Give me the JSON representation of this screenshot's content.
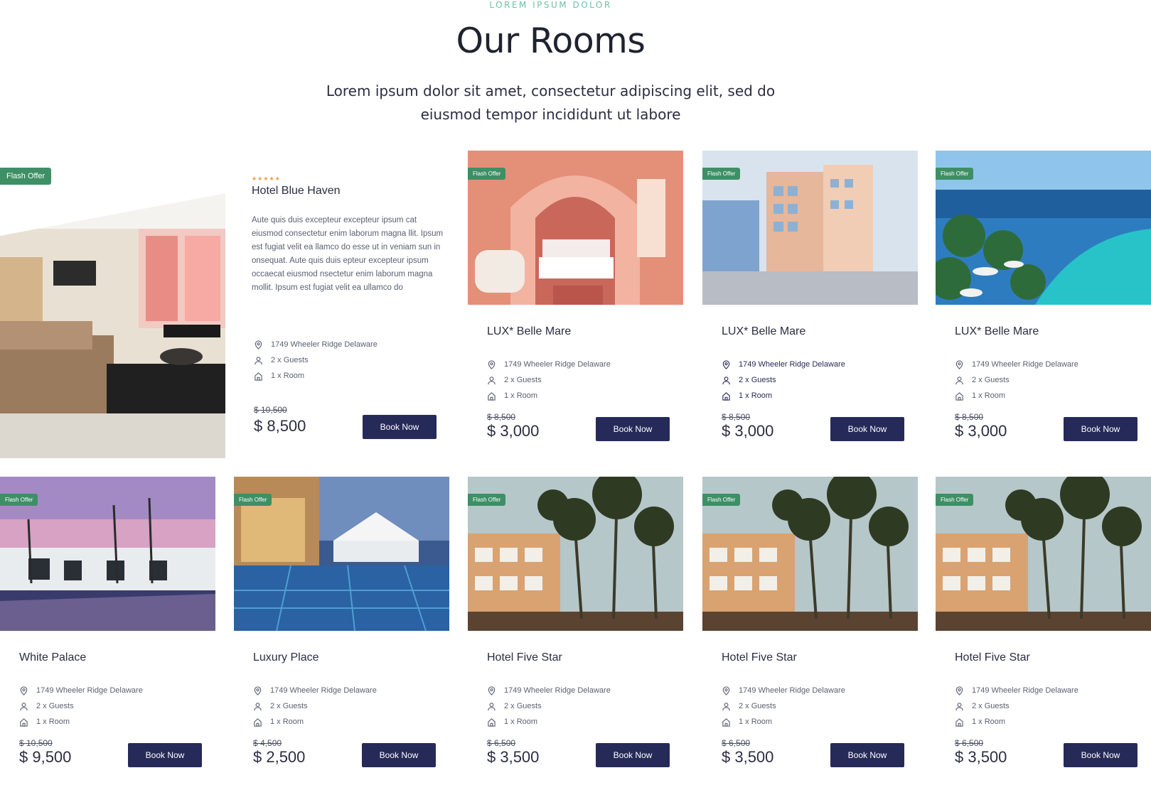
{
  "header": {
    "eyebrow": "LOREM IPSUM DOLOR",
    "title": "Our Rooms",
    "subtitle": "Lorem ipsum dolor sit amet, consectetur adipiscing elit, sed do eiusmod tempor incididunt ut labore"
  },
  "featured": {
    "flash": "Flash Offer",
    "stars": "★★★★★",
    "name": "Hotel Blue Haven",
    "description": "Aute quis duis excepteur excepteur ipsum cat eiusmod consectetur enim laborum magna llit. Ipsum est fugiat velit ea llamco do esse ut in veniam sun in onsequat. Aute quis duis epteur excepteur ipsum occaecat eiusmod nsectetur enim laborum magna mollit. Ipsum est fugiat velit ea ullamco do",
    "address": "1749 Wheeler Ridge  Delaware",
    "guests": "2 x Guests",
    "rooms": "1 x Room",
    "old_price": "$ 10,500",
    "price": "$ 8,500",
    "button": "Book Now"
  },
  "cards": [
    {
      "flash": "Flash Offer",
      "name": "LUX* Belle Mare",
      "address": "1749 Wheeler Ridge  Delaware",
      "guests": "2 x Guests",
      "rooms": "1 x Room",
      "old_price": "$ 8,500",
      "price": "$ 3,000",
      "button": "Book Now"
    },
    {
      "flash": "Flash Offer",
      "name": "LUX* Belle Mare",
      "address": "1749 Wheeler Ridge  Delaware",
      "guests": "2 x Guests",
      "rooms": "1 x Room",
      "old_price": "$ 8,500",
      "price": "$ 3,000",
      "button": "Book Now"
    },
    {
      "flash": "Flash Offer",
      "name": "LUX* Belle Mare",
      "address": "1749 Wheeler Ridge  Delaware",
      "guests": "2 x Guests",
      "rooms": "1 x Room",
      "old_price": "$ 8,500",
      "price": "$ 3,000",
      "button": "Book Now"
    },
    {
      "flash": "Flash Offer",
      "name": "White Palace",
      "address": "1749 Wheeler Ridge  Delaware",
      "guests": "2 x Guests",
      "rooms": "1 x Room",
      "old_price": "$ 10,500",
      "price": "$ 9,500",
      "button": "Book Now"
    },
    {
      "flash": "Flash Offer",
      "name": "Luxury Place",
      "address": "1749 Wheeler Ridge  Delaware",
      "guests": "2 x Guests",
      "rooms": "1 x Room",
      "old_price": "$ 4,500",
      "price": "$ 2,500",
      "button": "Book Now"
    },
    {
      "flash": "Flash Offer",
      "name": "Hotel Five Star",
      "address": "1749 Wheeler Ridge  Delaware",
      "guests": "2 x Guests",
      "rooms": "1 x Room",
      "old_price": "$ 6,500",
      "price": "$ 3,500",
      "button": "Book Now"
    },
    {
      "flash": "Flash Offer",
      "name": "Hotel Five Star",
      "address": "1749 Wheeler Ridge  Delaware",
      "guests": "2 x Guests",
      "rooms": "1 x Room",
      "old_price": "$ 6,500",
      "price": "$ 3,500",
      "button": "Book Now"
    },
    {
      "flash": "Flash Offer",
      "name": "Hotel Five Star",
      "address": "1749 Wheeler Ridge  Delaware",
      "guests": "2 x Guests",
      "rooms": "1 x Room",
      "old_price": "$ 6,500",
      "price": "$ 3,500",
      "button": "Book Now"
    }
  ],
  "icons": {
    "location": "location-pin-icon",
    "guests": "person-icon",
    "room": "home-icon"
  },
  "colors": {
    "accent": "#6cc3a4",
    "flash_badge": "#3e8f66",
    "button": "#262a58",
    "stars": "#f19a3e"
  }
}
